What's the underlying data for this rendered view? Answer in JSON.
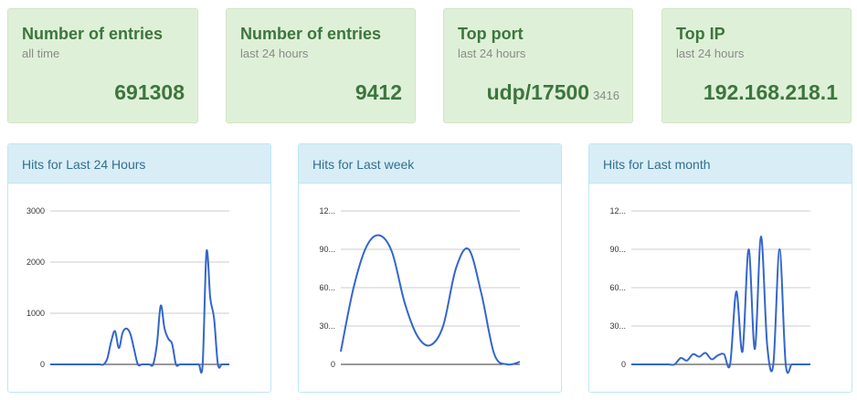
{
  "stats": [
    {
      "title": "Number of entries",
      "subtitle": "all time",
      "value": "691308",
      "count": ""
    },
    {
      "title": "Number of entries",
      "subtitle": "last 24 hours",
      "value": "9412",
      "count": ""
    },
    {
      "title": "Top port",
      "subtitle": "last 24 hours",
      "value": "udp/17500",
      "count": "3416"
    },
    {
      "title": "Top IP",
      "subtitle": "last 24 hours",
      "value": "192.168.218.1",
      "count": ""
    }
  ],
  "panels": [
    {
      "heading": "Hits for Last 24 Hours"
    },
    {
      "heading": "Hits for Last week"
    },
    {
      "heading": "Hits for Last month"
    }
  ],
  "colors": {
    "line": "#3366cc",
    "grid": "#cccccc",
    "stat_bg": "#dff0d8",
    "panel_heading_bg": "#d9edf7"
  },
  "chart_data": [
    {
      "type": "line",
      "title": "Hits for Last 24 Hours",
      "ylim": [
        0,
        3000
      ],
      "yticks": [
        "0",
        "1000",
        "2000",
        "3000"
      ],
      "yticks_values": [
        0,
        1000,
        2000,
        3000
      ],
      "x": [
        0,
        1,
        2,
        3,
        4,
        5,
        6,
        7,
        8,
        9,
        10,
        11,
        12,
        13,
        14,
        15,
        16,
        17,
        18,
        19,
        20,
        21,
        22,
        23,
        24,
        25,
        26,
        27,
        28,
        29,
        30,
        31,
        32,
        33,
        34,
        35,
        36,
        37,
        38,
        39,
        40,
        41,
        42,
        43,
        44,
        45,
        46,
        47
      ],
      "values": [
        0,
        0,
        0,
        0,
        0,
        0,
        0,
        0,
        0,
        0,
        0,
        0,
        0,
        0,
        0,
        120,
        450,
        650,
        320,
        620,
        700,
        600,
        300,
        0,
        0,
        0,
        0,
        0,
        400,
        1150,
        700,
        500,
        400,
        0,
        0,
        0,
        0,
        0,
        0,
        0,
        0,
        2200,
        1300,
        900,
        0,
        0,
        0,
        0
      ]
    },
    {
      "type": "line",
      "title": "Hits for Last week",
      "ylim": [
        0,
        120
      ],
      "yticks": [
        "0",
        "30...",
        "60...",
        "90...",
        "12..."
      ],
      "yticks_values": [
        0,
        30,
        60,
        90,
        120
      ],
      "x": [
        0,
        1,
        2,
        3,
        4,
        5,
        6,
        7,
        8,
        9,
        10,
        11,
        12,
        13,
        14
      ],
      "values": [
        10,
        60,
        92,
        101,
        88,
        48,
        22,
        15,
        30,
        75,
        90,
        55,
        8,
        0,
        2
      ]
    },
    {
      "type": "line",
      "title": "Hits for Last month",
      "ylim": [
        0,
        120
      ],
      "yticks": [
        "0",
        "30...",
        "60...",
        "90...",
        "12..."
      ],
      "yticks_values": [
        0,
        30,
        60,
        90,
        120
      ],
      "x": [
        0,
        1,
        2,
        3,
        4,
        5,
        6,
        7,
        8,
        9,
        10,
        11,
        12,
        13,
        14,
        15,
        16,
        17,
        18,
        19,
        20,
        21,
        22,
        23,
        24,
        25,
        26,
        27,
        28,
        29
      ],
      "values": [
        0,
        0,
        0,
        0,
        0,
        0,
        0,
        0,
        5,
        3,
        8,
        6,
        9,
        4,
        7,
        8,
        0,
        57,
        10,
        90,
        12,
        100,
        15,
        0,
        90,
        0,
        0,
        0,
        0,
        0
      ]
    }
  ]
}
